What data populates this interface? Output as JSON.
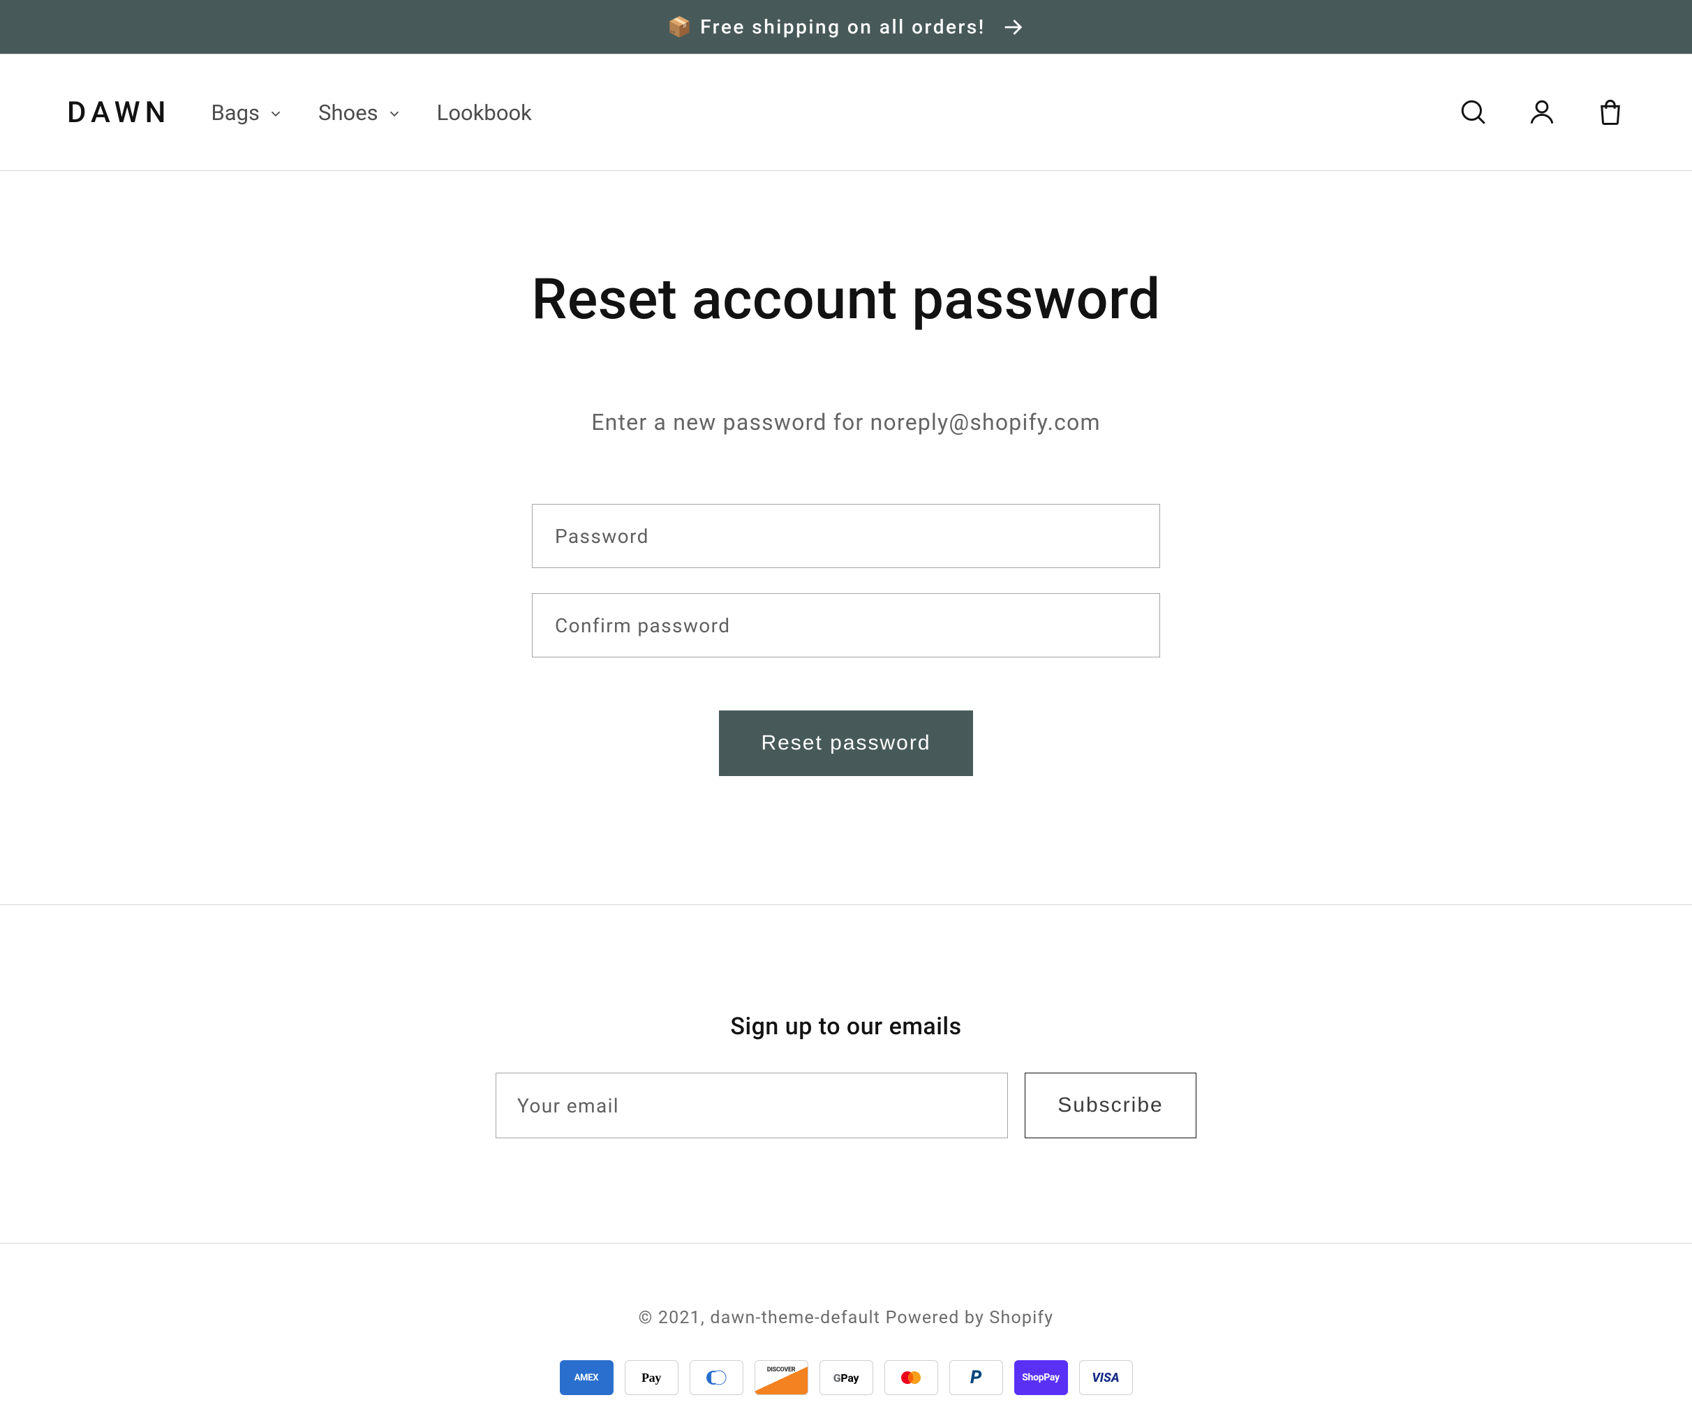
{
  "announcement": {
    "text": "📦  Free shipping on all orders!"
  },
  "header": {
    "logo": "DAWN",
    "nav": {
      "bags": "Bags",
      "shoes": "Shoes",
      "lookbook": "Lookbook"
    }
  },
  "page": {
    "title": "Reset account password",
    "intro": "Enter a new password for noreply@shopify.com",
    "password_label": "Password",
    "confirm_label": "Confirm password",
    "submit_label": "Reset password"
  },
  "newsletter": {
    "title": "Sign up to our emails",
    "email_placeholder": "Your email",
    "subscribe_label": "Subscribe"
  },
  "footer": {
    "copyright": "© 2021, dawn-theme-default Powered by Shopify",
    "payments": {
      "amex": "AMEX",
      "apple": "Pay",
      "gpay_g": "G",
      "gpay_pay": " Pay",
      "discover": "DISCOVER",
      "paypal": "P",
      "shop": "ShopPay",
      "visa": "VISA"
    }
  }
}
